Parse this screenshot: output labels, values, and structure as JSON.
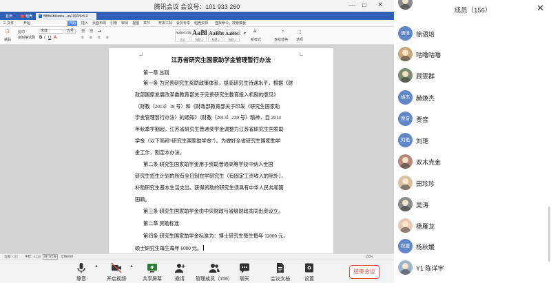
{
  "meeting": {
    "title": "腾讯会议  会议号：101 933 260",
    "controls": {
      "minimize": "—",
      "maximize": "□",
      "close": "✕"
    }
  },
  "wps": {
    "tabs": [
      {
        "label": "首页",
        "color": "#2c5fb5"
      },
      {
        "label": "稻壳",
        "color": "#e84c3d"
      },
      {
        "label": "5ff8b4b8aaca...aa1006f9c9.0",
        "color": "#2c6bd6"
      }
    ],
    "menu": [
      "三 文件",
      "开始",
      "插入",
      "页面布局",
      "引用",
      "审阅",
      "视图",
      "章节",
      "开发工具",
      "会员专享",
      "稻壳资源",
      "查找命令、搜索模板"
    ],
    "menu_active": "开始",
    "ribbon": {
      "paste": "粘贴",
      "cut": "剪切",
      "copy": "复制",
      "format_painter": "格式刷",
      "font_name": "宋体",
      "font_size": "五号",
      "styles": [
        {
          "sample": "AaBbCcDi",
          "name": "正文"
        },
        {
          "sample": "AaBl",
          "name": "标题 1"
        },
        {
          "sample": "AaBbt",
          "name": "标题 2"
        },
        {
          "sample": "AaBbC",
          "name": "标题 3"
        }
      ],
      "new_style": "新样式",
      "find_replace": "查找替换",
      "select": "选择"
    },
    "document": {
      "title": "江苏省研究生国家助学金管理暂行办法",
      "lines": [
        "第一章    总则",
        "第一条    为完善研究生奖助政策体系，提高研究生待遇水平，根据《财",
        "政部国家发展改革委教育部关于完善研究生教育投入机制的意见》",
        "（财教〔2013〕19 号）和《财政部教育部关于印发〈研究生国家助",
        "学金管理暂行办法〉的通知》（财教〔2013〕220 号）精神，自 2014",
        "年秋季学期起，江苏省研究生普通奖学金调整为江苏省研究生国家助",
        "学金（以下简称“研究生国家助学金”）。为做好全省研究生国家助学",
        "金工作，制定本办法。",
        "第二条    研究生国家助学金用于资助普通高等学校中纳入全国",
        "研究生招生计划的所有全日制在学研究生（有固定工资收入的除外），",
        "补助研究生基本生活支出。获得资助的研究生须具有中华人民共和国",
        "国籍。",
        "第三条    研究生国家助学金由中央财政与省级财政共同出资设立。",
        "第二章    资助标准",
        "第四条    研究生国家助学金标准为：博士研究生每生每年 12000 元，",
        "硕士研究生每生每年 6000 元。"
      ]
    },
    "status": {
      "page": "页面：1/3",
      "words": "字数：1118",
      "spellcheck": "拼写检查",
      "doc_check": "文档校对",
      "zoom": "100%"
    }
  },
  "toolbar": {
    "items": [
      {
        "label": "静音",
        "icon": "microphone-icon"
      },
      {
        "label": "开启视频",
        "icon": "video-camera-icon"
      },
      {
        "label": "共享屏幕",
        "icon": "screen-share-icon"
      },
      {
        "label": "邀请",
        "icon": "invite-user-icon"
      },
      {
        "label": "管理成员（156）",
        "icon": "members-icon"
      },
      {
        "label": "聊天",
        "icon": "chat-icon"
      },
      {
        "label": "会议文档",
        "icon": "document-icon"
      },
      {
        "label": "设置",
        "icon": "settings-icon"
      }
    ],
    "end_label": "结束会议",
    "accent": "#e04848"
  },
  "members": {
    "title": "成员（156）",
    "close": "✕",
    "list": [
      {
        "name": "徐语培",
        "avatar_text": "语培",
        "photo": false
      },
      {
        "name": "咕噜咕噜",
        "avatar_text": "",
        "photo": true,
        "tone": "p1"
      },
      {
        "name": "顾雯群",
        "avatar_text": "",
        "photo": true,
        "tone": "p2"
      },
      {
        "name": "赫焕杰",
        "avatar_text": "焕杰",
        "photo": false
      },
      {
        "name": "贾音",
        "avatar_text": "贾音",
        "photo": false
      },
      {
        "name": "刘艳",
        "avatar_text": "刘艳",
        "photo": false
      },
      {
        "name": "双木克金",
        "avatar_text": "",
        "photo": true,
        "tone": "p3"
      },
      {
        "name": "田珍珍",
        "avatar_text": "",
        "photo": true,
        "tone": "p4"
      },
      {
        "name": "吴涛",
        "avatar_text": "",
        "photo": true,
        "tone": "p5"
      },
      {
        "name": "杨雁龙",
        "avatar_text": "",
        "photo": true,
        "tone": "p6"
      },
      {
        "name": "杨秋媛",
        "avatar_text": "秋媛",
        "photo": false
      },
      {
        "name": "Y1 陈洋宇",
        "avatar_text": "",
        "photo": true,
        "tone": "p7"
      }
    ]
  }
}
